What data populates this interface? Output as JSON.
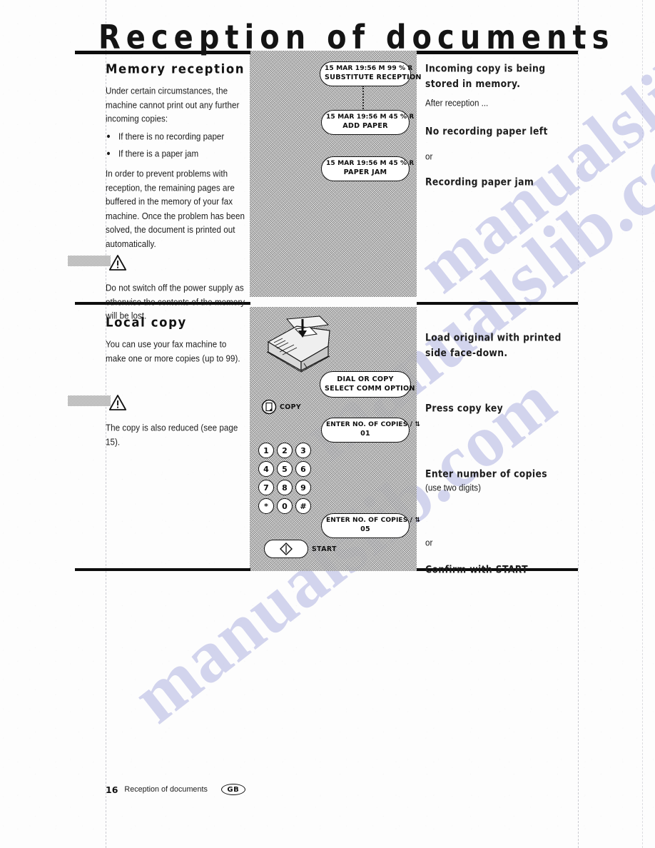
{
  "page": {
    "title": "Reception of documents",
    "footer": {
      "page_number": "16",
      "footer_text": "Reception of documents",
      "language_badge": "GB"
    },
    "watermark": "manualslib.com"
  },
  "sections": [
    {
      "id": "memory-reception",
      "heading": "Memory reception",
      "paragraphs": [
        "Under certain circumstances, the machine cannot print out any further incoming copies:"
      ],
      "bullets": [
        "If there is no recording paper",
        "If there is a paper jam"
      ],
      "paragraph2": "In order to prevent problems with reception, the remaining pages are buffered in the memory of your fax machine. Once the problem has been solved, the document is printed out automatically.",
      "warning": "Do not switch off the power supply as otherwise the contents of the memory will be lost.",
      "displays": [
        {
          "line1_left": "15 MAR 19:56 M 99 %",
          "line1_right": "R",
          "line2": "SUBSTITUTE RECEPTION"
        },
        {
          "line1_left": "15 MAR 19:56 M 45 %",
          "line1_right": "R",
          "line2": "ADD PAPER"
        },
        {
          "line1_left": "15 MAR 19:56 M 45 %",
          "line1_right": "R",
          "line2": "PAPER JAM"
        }
      ],
      "notes": [
        {
          "text": "Incoming copy is being stored in memory.",
          "bold": true
        },
        {
          "text": "After reception ...",
          "bold": false
        },
        {
          "text": "No recording paper left",
          "bold": true
        },
        {
          "text": "or",
          "bold": false
        },
        {
          "text": "Recording paper jam",
          "bold": true
        }
      ]
    },
    {
      "id": "local-copy",
      "heading": "Local copy",
      "paragraphs": [
        "You can use your fax machine to make one or more copies (up to 99)."
      ],
      "warning": "The copy is also reduced (see page 15).",
      "displays": [
        {
          "line1": "DIAL OR COPY",
          "line2": "SELECT COMM OPTION"
        },
        {
          "line1": "ENTER NO. OF COPIES /",
          "line1_icon": "copies-icon",
          "line2": "01"
        },
        {
          "line1": "ENTER NO. OF COPIES /",
          "line1_icon": "copies-icon",
          "line2": "05"
        }
      ],
      "copy_key_label": "COPY",
      "start_key_label": "START",
      "keypad": [
        "1",
        "2",
        "3",
        "4",
        "5",
        "6",
        "7",
        "8",
        "9",
        "*",
        "0",
        "#"
      ],
      "notes": [
        {
          "text": "Load original with printed side face-down.",
          "bold": true
        },
        {
          "text": "Press copy key",
          "bold": true
        },
        {
          "text": "Enter number of copies",
          "bold": true
        },
        {
          "text": "(use two digits)",
          "bold": false
        },
        {
          "text": "or",
          "bold": false
        },
        {
          "text": "Confirm with START",
          "bold": true
        }
      ]
    }
  ],
  "colors": {
    "ink": "#111111",
    "panel_gray": "#cfcfcf",
    "watermark": "#b9bbe4"
  }
}
